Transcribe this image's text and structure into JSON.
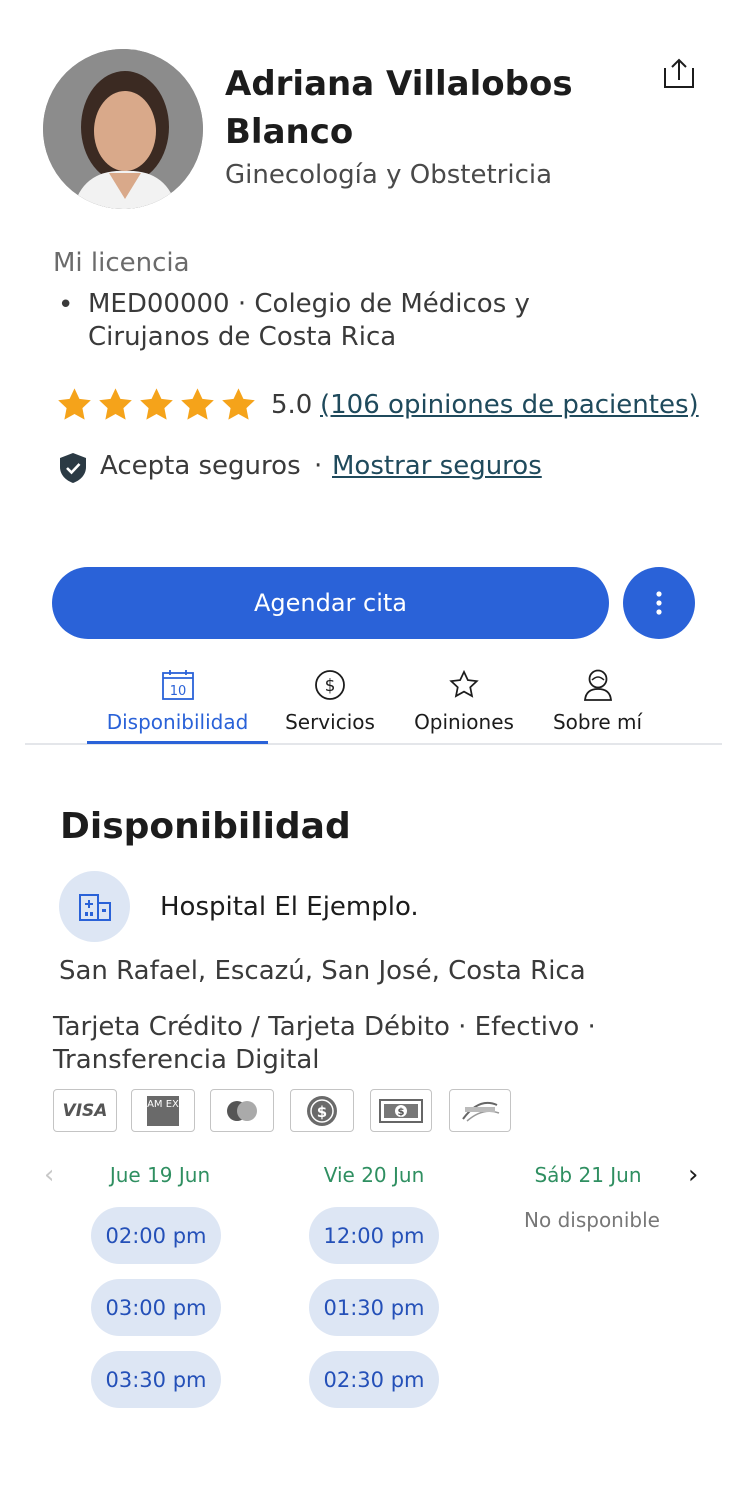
{
  "doctor": {
    "name": "Adriana Villalobos Blanco",
    "specialty": "Ginecología y Obstetricia"
  },
  "license": {
    "title": "Mi licencia",
    "items": [
      "MED00000 · Colegio de Médicos y Cirujanos de Costa Rica"
    ]
  },
  "rating": {
    "value": "5.0",
    "stars": 5,
    "reviews_link": "(106 opiniones de pacientes)"
  },
  "insurance": {
    "text": "Acepta seguros",
    "separator": "·",
    "link": "Mostrar seguros"
  },
  "actions": {
    "book_label": "Agendar cita"
  },
  "tabs": [
    {
      "label": "Disponibilidad",
      "icon": "calendar-icon",
      "icon_text": "10",
      "active": true
    },
    {
      "label": "Servicios",
      "icon": "dollar-icon",
      "active": false
    },
    {
      "label": "Opiniones",
      "icon": "star-outline-icon",
      "active": false
    },
    {
      "label": "Sobre mí",
      "icon": "person-icon",
      "active": false
    }
  ],
  "availability": {
    "title": "Disponibilidad",
    "hospital": "Hospital El Ejemplo.",
    "address": "San Rafael, Escazú, San José, Costa Rica",
    "payment_methods": "Tarjeta Crédito / Tarjeta Débito · Efectivo · Transferencia Digital",
    "payment_icons": [
      {
        "name": "visa-icon",
        "text": "VISA"
      },
      {
        "name": "amex-icon",
        "text": "AM EX"
      },
      {
        "name": "mastercard-icon"
      },
      {
        "name": "cash-coin-icon"
      },
      {
        "name": "cash-bill-icon"
      },
      {
        "name": "sinpe-movil-icon"
      }
    ],
    "days": [
      {
        "label": "Jue 19 Jun",
        "slots": [
          "02:00 pm",
          "03:00 pm",
          "03:30 pm"
        ]
      },
      {
        "label": "Vie 20 Jun",
        "slots": [
          "12:00 pm",
          "01:30 pm",
          "02:30 pm"
        ]
      },
      {
        "label": "Sáb 21 Jun",
        "slots": [],
        "unavailable_text": "No disponible"
      }
    ]
  },
  "colors": {
    "primary": "#2a62d8",
    "star": "#f5a31a",
    "day_label": "#2f8f61",
    "slot_bg": "#dde6f4",
    "link": "#1f4a5c"
  }
}
